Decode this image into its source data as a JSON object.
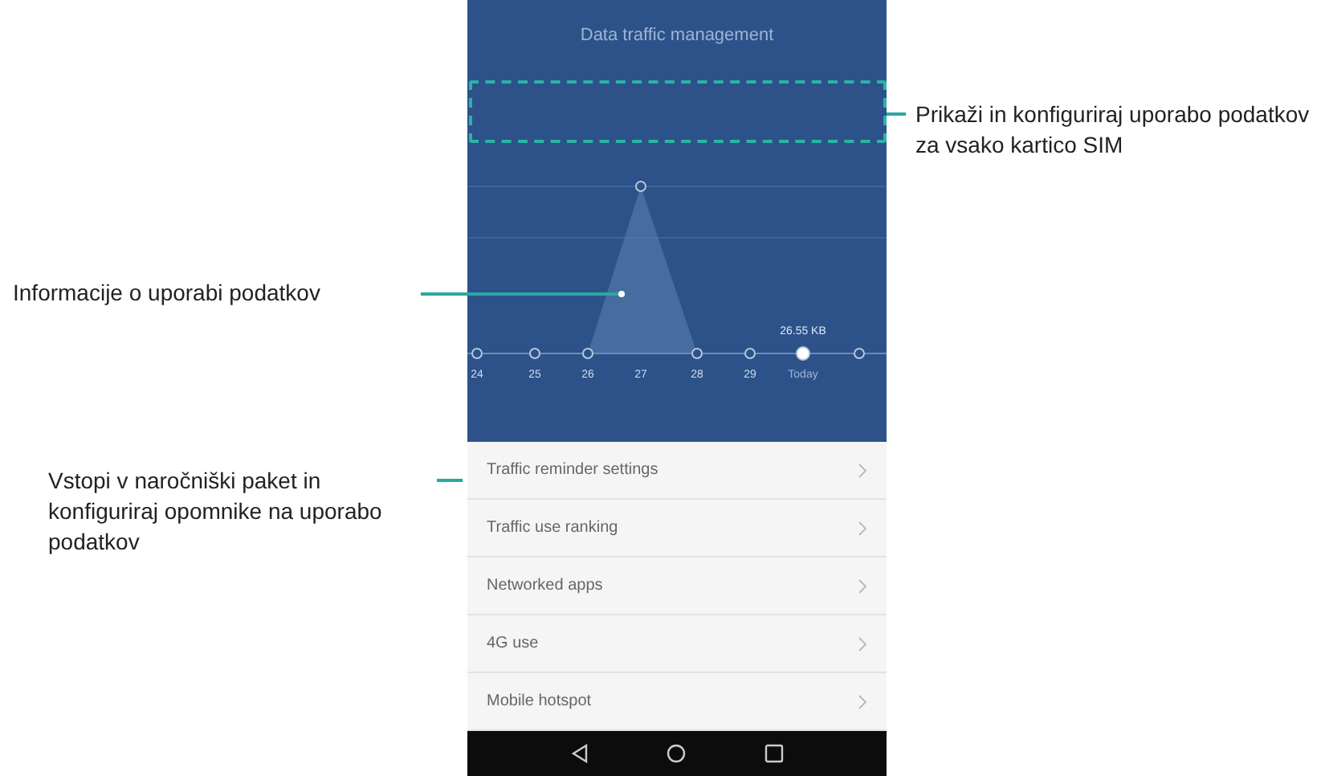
{
  "screen": {
    "title": "Data traffic management",
    "usage_chart": {
      "reading": "26.55 KB",
      "points": [
        {
          "label": "24",
          "selected": false
        },
        {
          "label": "25",
          "selected": false
        },
        {
          "label": "26",
          "selected": false
        },
        {
          "label": "27",
          "selected": false
        },
        {
          "label": "28",
          "selected": false
        },
        {
          "label": "29",
          "selected": false
        },
        {
          "label": "Today",
          "selected": true
        },
        {
          "selected": false
        }
      ]
    },
    "menu": [
      {
        "label": "Traffic reminder settings"
      },
      {
        "label": "Traffic use ranking"
      },
      {
        "label": "Networked apps"
      },
      {
        "label": "4G use"
      },
      {
        "label": "Mobile hotspot"
      }
    ]
  },
  "callouts": {
    "sim_cards": "Prikaži in konfiguriraj uporabo podatkov za vsako kartico SIM",
    "usage_info": "Informacije o uporabi podatkov",
    "reminders": "Vstopi v naročniški paket in konfiguriraj opomnike na uporabo podatkov"
  }
}
